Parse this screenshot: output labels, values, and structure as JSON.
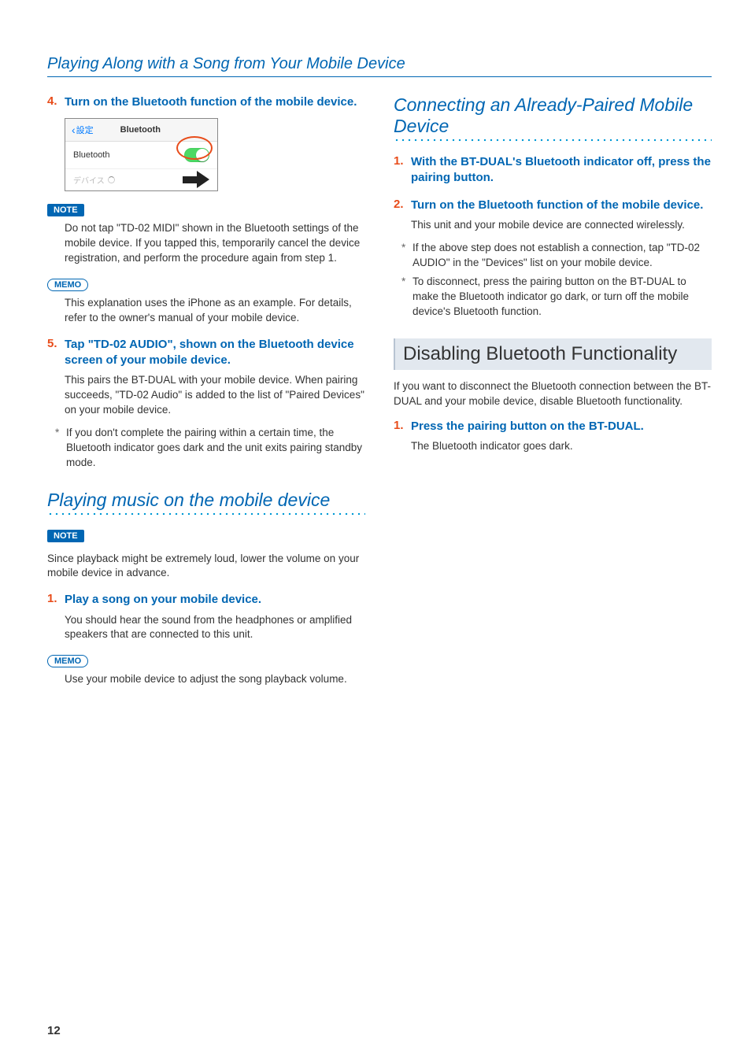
{
  "header": {
    "title": "Playing Along with a Song from Your Mobile Device"
  },
  "left": {
    "step4": {
      "num": "4.",
      "title": "Turn on the Bluetooth function of the mobile device."
    },
    "bt_shot": {
      "back": "設定",
      "title": "Bluetooth",
      "row_label": "Bluetooth",
      "row2_label": "デバイス"
    },
    "note1": {
      "label": "NOTE",
      "text": "Do not tap \"TD-02 MIDI\" shown in the Bluetooth settings of the mobile device. If you tapped this, temporarily cancel the device registration, and perform the procedure again from step 1."
    },
    "memo1": {
      "label": "MEMO",
      "text": "This explanation uses the iPhone as an example. For details, refer to the owner's manual of your mobile device."
    },
    "step5": {
      "num": "5.",
      "title": "Tap \"TD-02 AUDIO\", shown on the Bluetooth device screen of your mobile device.",
      "body": "This pairs the BT-DUAL with your mobile device. When pairing succeeds, \"TD-02 Audio\" is added to the list of \"Paired Devices\" on your mobile device.",
      "bullet": "If you don't complete the pairing within a certain time, the Bluetooth indicator goes dark and the unit exits pairing standby mode."
    },
    "h2a": "Playing music on the mobile device",
    "note2": {
      "label": "NOTE",
      "text": "Since playback might be extremely loud, lower the volume on your mobile device in advance."
    },
    "step_play1": {
      "num": "1.",
      "title": "Play a song on your mobile device.",
      "body": "You should hear the sound from the headphones or amplified speakers that are connected to this unit."
    },
    "memo2": {
      "label": "MEMO",
      "text": "Use your mobile device to adjust the song playback volume."
    }
  },
  "right": {
    "h2a": "Connecting an Already-Paired Mobile Device",
    "step1": {
      "num": "1.",
      "title": "With the BT-DUAL's Bluetooth indicator off, press the pairing button."
    },
    "step2": {
      "num": "2.",
      "title": "Turn on the Bluetooth function of the mobile device.",
      "body": "This unit and your mobile device are connected wirelessly.",
      "bullet1": "If the above step does not establish a connection, tap \"TD-02 AUDIO\" in the \"Devices\" list on your mobile device.",
      "bullet2": "To disconnect, press the pairing button on the BT-DUAL to make the Bluetooth indicator go dark, or turn off the mobile device's Bluetooth function."
    },
    "h2b": "Disabling Bluetooth Functionality",
    "intro": "If you want to disconnect the Bluetooth connection between the BT-DUAL and your mobile device, disable Bluetooth functionality.",
    "step_d1": {
      "num": "1.",
      "title": "Press the pairing button on the BT-DUAL.",
      "body": "The Bluetooth indicator goes dark."
    }
  },
  "page_number": "12"
}
